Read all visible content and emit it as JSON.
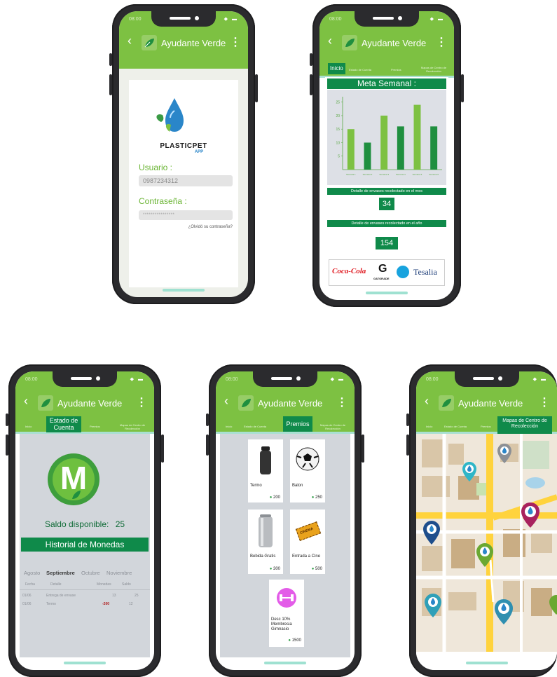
{
  "app": {
    "title": "Ayudante Verde",
    "time": "08:00"
  },
  "colors": {
    "header_green": "#7dc142",
    "dark_green": "#0f8a4a",
    "bar_light": "#7dc142",
    "bar_dark": "#1f8f3f",
    "accent_cyan": "#9fe1d1"
  },
  "login": {
    "brand_name": "PLASTICPET",
    "brand_sub": "APP",
    "user_label": "Usuario :",
    "user_value": "0987234312",
    "password_label": "Contraseña :",
    "password_value": "****************",
    "forgot_link": "¿Olvidó su contraseña?"
  },
  "tabs": [
    "Inicio",
    "Estado de Cuenta",
    "Premios",
    "Mapas de Centro de Recolección"
  ],
  "home": {
    "meta_title": "Meta Semanal :",
    "month_label": "Detalle de envases recolectado en el mes",
    "month_value": "34",
    "year_label": "Detalle de envases recolectado en el año",
    "year_value": "154",
    "sponsors": [
      "Coca-Cola",
      "G",
      "GATORADE",
      "Tesalia"
    ]
  },
  "chart_data": {
    "type": "bar",
    "categories": [
      "Semana 1",
      "Semana 2",
      "Semana 3",
      "Semana 4",
      "Semana 5",
      "Semana 6"
    ],
    "values": [
      15,
      10,
      20,
      16,
      24,
      16
    ],
    "ylim": [
      0,
      27
    ],
    "yticks": [
      5,
      10,
      15,
      20,
      25
    ],
    "title": "Meta Semanal :",
    "xlabel": "",
    "ylabel": ""
  },
  "account": {
    "monogram": "M",
    "balance_label": "Saldo disponible:",
    "balance_value": "25",
    "history_title": "Historial de Monedas",
    "months": [
      "Agosto",
      "Septiembre",
      "Octubre",
      "Noviembre"
    ],
    "columns": [
      "Fecha",
      "Detalle",
      "Monedas",
      "Saldo"
    ],
    "rows": [
      {
        "date": "01/06",
        "detail": "Entrega de envase",
        "coins": "13",
        "balance": "25"
      },
      {
        "date": "01/06",
        "detail": "Termo",
        "coins": "-200",
        "balance": "12"
      }
    ]
  },
  "prizes": [
    {
      "name": "Termo",
      "price": "200",
      "icon": "bottle-icon"
    },
    {
      "name": "Balon",
      "price": "250",
      "icon": "soccer-ball-icon"
    },
    {
      "name": "Bebida Gratis",
      "price": "300",
      "icon": "can-icon"
    },
    {
      "name": "Entrada a Cine",
      "price": "500",
      "icon": "cinema-ticket-icon",
      "ticket_text": "CINEMA"
    },
    {
      "name": "Desc 10% Membresia Gimnasio",
      "price": "1500",
      "icon": "dumbbell-icon"
    }
  ]
}
